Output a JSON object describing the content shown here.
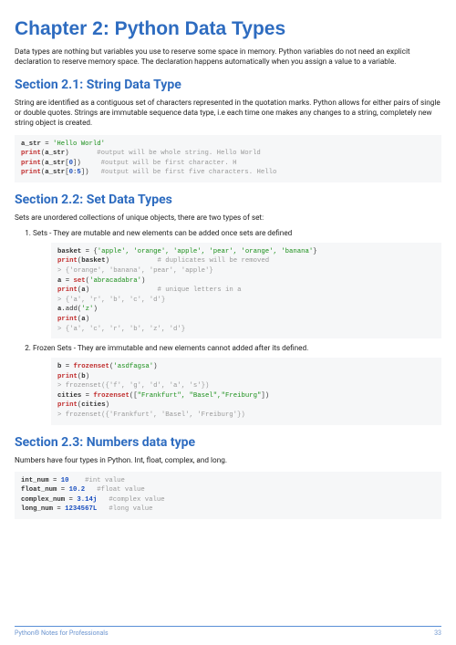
{
  "chapter": {
    "title": "Chapter 2: Python Data Types"
  },
  "intro": "Data types are nothing but variables you use to reserve some space in memory. Python variables do not need an explicit declaration to reserve memory space. The declaration happens automatically when you assign a value to a variable.",
  "sections": {
    "s21": {
      "title": "Section 2.1: String Data Type",
      "text": "String are identified as a contiguous set of characters represented in the quotation marks. Python allows for either pairs of single or double quotes. Strings are immutable sequence data type, i.e each time one makes any changes to a string, completely new string object is created."
    },
    "s22": {
      "title": "Section 2.2: Set Data Types",
      "text": "Sets are unordered collections of unique objects, there are two types of set:",
      "li1": "Sets - They are mutable and new elements can be added once sets are defined",
      "li2": "Frozen Sets - They are immutable and new elements cannot added after its defined."
    },
    "s23": {
      "title": "Section 2.3: Numbers data type",
      "text": "Numbers have four types in Python. Int, float, complex, and long."
    }
  },
  "code": {
    "c21": {
      "l1_var": "a_str",
      "l1_eq": " = ",
      "l1_str": "'Hello World'",
      "l2_kw": "print",
      "l2_open": "(",
      "l2_var": "a_str",
      "l2_close": ")       ",
      "l2_com": "#output will be whole string. Hello World",
      "l3_kw": "print",
      "l3_open": "(",
      "l3_var": "a_str",
      "l3_idx": "[",
      "l3_num": "0",
      "l3_idx2": "])     ",
      "l3_com": "#output will be first character. H",
      "l4_kw": "print",
      "l4_open": "(",
      "l4_var": "a_str",
      "l4_idx": "[",
      "l4_n1": "0",
      "l4_colon": ":",
      "l4_n2": "5",
      "l4_idx2": "])   ",
      "l4_com": "#output will be first five characters. Hello"
    },
    "c22a": {
      "l1_v": "basket",
      "l1_e": " = {",
      "l1_s": "'apple', 'orange', 'apple', 'pear', 'orange', 'banana'",
      "l1_c": "}",
      "l2_kw": "print",
      "l2_o": "(",
      "l2_v": "basket",
      "l2_c": ")            ",
      "l2_com": "# duplicates will be removed",
      "l3_out": "> {'orange', 'banana', 'pear', 'apple'}",
      "l4_v": "a",
      "l4_e": " = ",
      "l4_kw": "set",
      "l4_o": "(",
      "l4_s": "'abracadabra'",
      "l4_c": ")",
      "l5_kw": "print",
      "l5_o": "(",
      "l5_v": "a",
      "l5_c": ")                 ",
      "l5_com": "# unique letters in a",
      "l6_out": "> {'a', 'r', 'b', 'c', 'd'}",
      "l7_v": "a",
      "l7_call": ".add(",
      "l7_s": "'z'",
      "l7_c": ")",
      "l8_kw": "print",
      "l8_o": "(",
      "l8_v": "a",
      "l8_c": ")",
      "l9_out": "> {'a', 'c', 'r', 'b', 'z', 'd'}"
    },
    "c22b": {
      "l1_v": "b",
      "l1_e": " = ",
      "l1_kw": "frozenset",
      "l1_o": "(",
      "l1_s": "'asdfagsa'",
      "l1_c": ")",
      "l2_kw": "print",
      "l2_o": "(",
      "l2_v": "b",
      "l2_c": ")",
      "l3_out": "> frozenset({'f', 'g', 'd', 'a', 's'})",
      "l4_v": "cities",
      "l4_e": " = ",
      "l4_kw": "frozenset",
      "l4_o": "([",
      "l4_s": "\"Frankfurt\", \"Basel\",\"Freiburg\"",
      "l4_c": "])",
      "l5_kw": "print",
      "l5_o": "(",
      "l5_v": "cities",
      "l5_c": ")",
      "l6_out": "> frozenset({'Frankfurt', 'Basel', 'Freiburg'})"
    },
    "c23": {
      "l1_v": "int_num",
      "l1_e": " = ",
      "l1_n": "10",
      "l1_sp": "    ",
      "l1_c": "#int value",
      "l2_v": "float_num",
      "l2_e": " = ",
      "l2_n": "10.2",
      "l2_sp": "   ",
      "l2_c": "#float value",
      "l3_v": "complex_num",
      "l3_e": " = ",
      "l3_n": "3.14j",
      "l3_sp": "   ",
      "l3_c": "#complex value",
      "l4_v": "long_num",
      "l4_e": " = ",
      "l4_n": "1234567L",
      "l4_sp": "   ",
      "l4_c": "#long value"
    }
  },
  "footer": {
    "left": "Python® Notes for Professionals",
    "right": "33"
  }
}
